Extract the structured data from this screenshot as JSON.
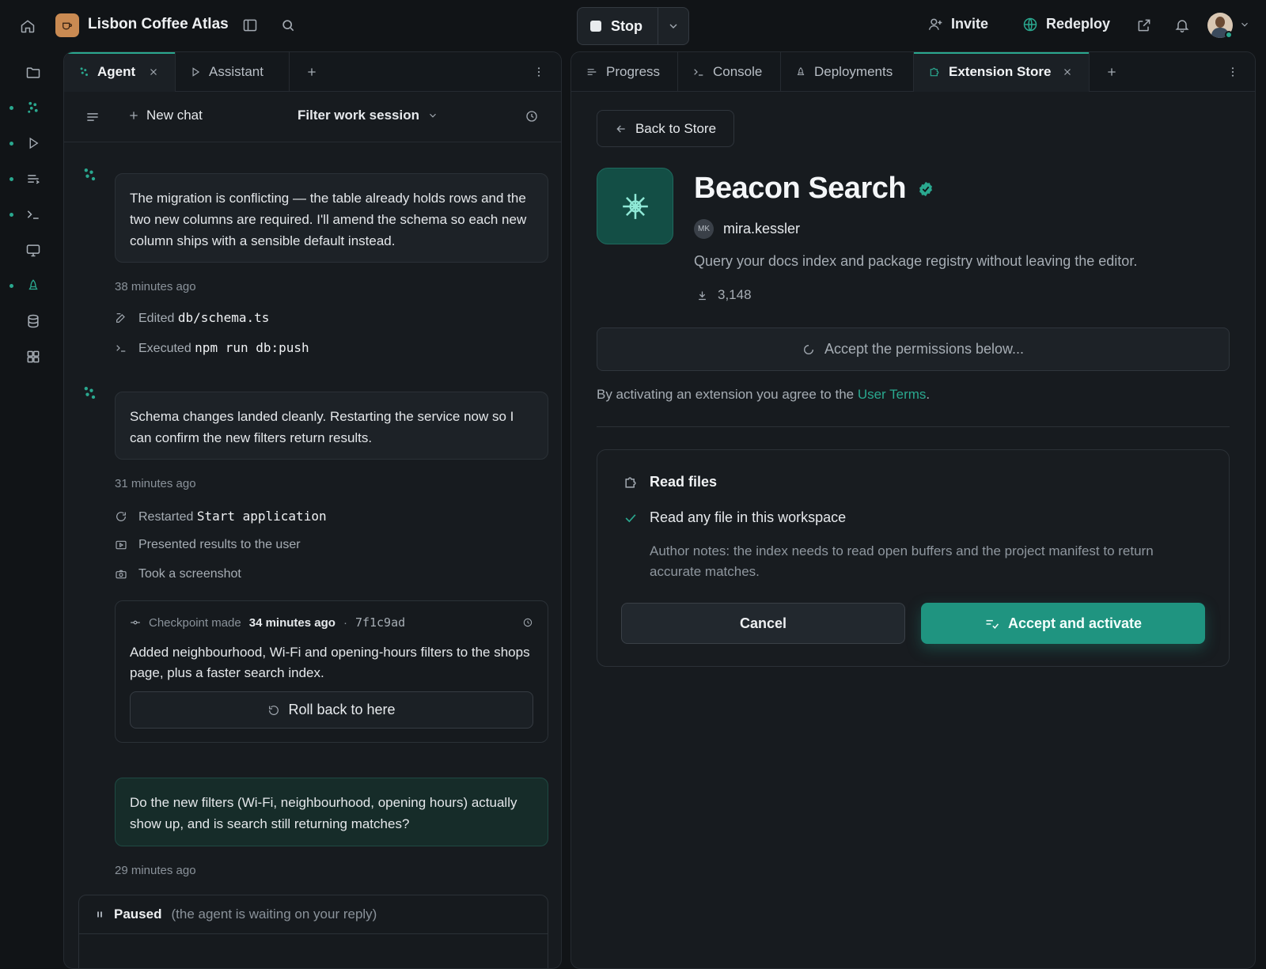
{
  "app": {
    "title": "Lisbon Coffee Atlas"
  },
  "header": {
    "stop_label": "Stop",
    "invite_label": "Invite",
    "redeploy_label": "Redeploy"
  },
  "left_tabs": [
    {
      "label": "Agent"
    },
    {
      "label": "Assistant"
    }
  ],
  "chat_toolbar": {
    "new_chat": "New chat",
    "session": "Filter work session"
  },
  "messages": [
    {
      "text": "The migration is conflicting — the table already holds rows and the two new columns are required. I'll amend the schema so each new column ships with a sensible default instead.",
      "time": "38 minutes ago",
      "actions": [
        {
          "verb": "Edited",
          "target": "db/schema.ts"
        },
        {
          "verb": "Executed",
          "target": "npm run db:push"
        }
      ]
    },
    {
      "text": "Schema changes landed cleanly. Restarting the service now so I can confirm the new filters return results.",
      "time": "31 minutes ago",
      "actions": [
        {
          "verb": "Restarted",
          "target": "Start application"
        },
        {
          "verb": "Presented results to the user",
          "target": ""
        },
        {
          "verb": "Took a screenshot",
          "target": ""
        }
      ]
    }
  ],
  "checkpoint": {
    "label": "Checkpoint made",
    "time": "34 minutes ago",
    "hash": "7f1c9ad",
    "text": "Added neighbourhood, Wi-Fi and opening-hours filters to the shops page, plus a faster search index.",
    "rollback": "Roll back to here"
  },
  "user_message": {
    "text": "Do the new filters (Wi-Fi, neighbourhood, opening hours) actually show up, and is search still returning matches?",
    "time": "29 minutes ago"
  },
  "status": {
    "label": "Paused",
    "detail": "(the agent is waiting on your reply)"
  },
  "right_tabs": [
    {
      "label": "Progress"
    },
    {
      "label": "Console"
    },
    {
      "label": "Deployments"
    },
    {
      "label": "Extension Store"
    }
  ],
  "extension": {
    "back": "Back to Store",
    "name": "Beacon Search",
    "author_initials": "MK",
    "author": "mira.kessler",
    "description": "Query your docs index and package registry without leaving the editor.",
    "downloads": "3,148",
    "pending": "Accept the permissions below...",
    "terms_prefix": "By activating an extension you agree to the ",
    "terms_link": "User Terms",
    "terms_suffix": ".",
    "permission_title": "Read files",
    "permission_item": "Read any file in this workspace",
    "author_notes": "Author notes: the index needs to read open buffers and the project manifest to return accurate matches.",
    "cancel": "Cancel",
    "accept": "Accept and activate"
  },
  "colors": {
    "accent": "#2aa88f",
    "accent_button": "#1f9480",
    "background": "#111417"
  }
}
